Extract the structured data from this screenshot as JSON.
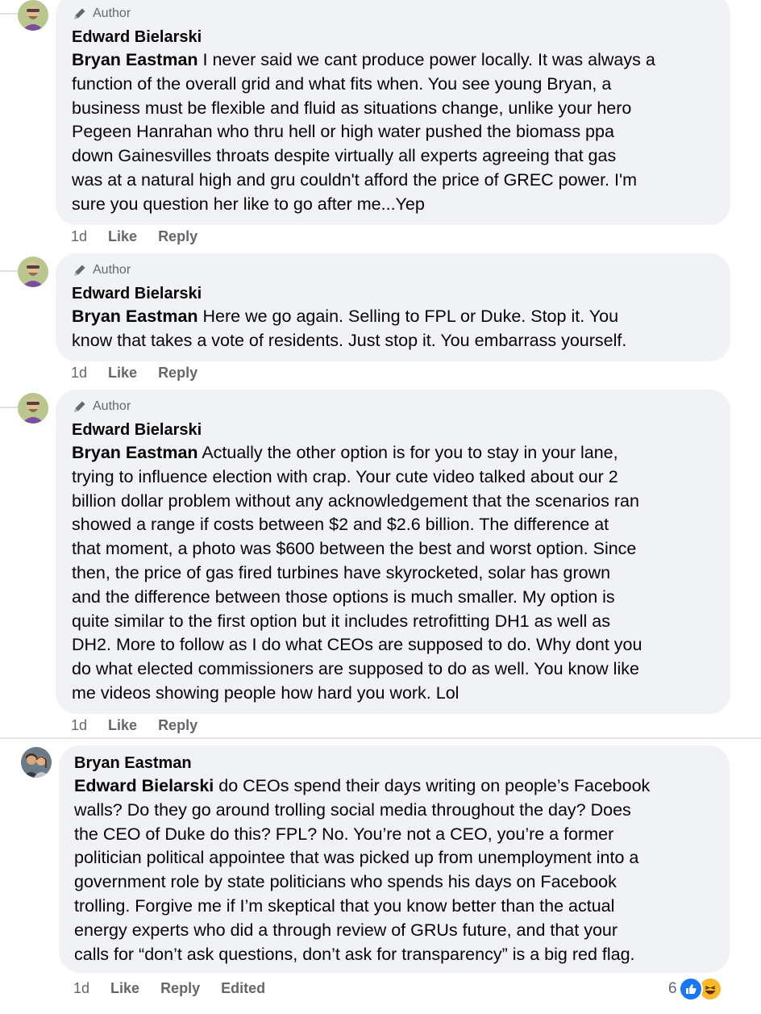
{
  "colors": {
    "bubble": "#f0f2f5",
    "text": "#050505",
    "meta": "#65676b",
    "like_blue": "#1877f2",
    "haha_yellow": "#f7b928"
  },
  "comments": [
    {
      "badge": "Author",
      "name": "Edward Bielarski",
      "mention": "Bryan Eastman",
      "lines": [
        " I never said we cant produce power locally. It was always a",
        "function of the overall grid and what fits when. You see young Bryan, a",
        "business must be flexible and fluid as situations change, unlike your hero",
        "Pegeen Hanrahan who thru hell or high water pushed the biomass ppa",
        "down Gainesvilles throats despite virtually all experts agreeing that gas",
        "was at a natural high and gru couldn't afford the price of GREC power. I'm",
        "sure you question her like to go after me...Yep"
      ],
      "time": "1d",
      "like": "Like",
      "reply": "Reply"
    },
    {
      "badge": "Author",
      "name": "Edward Bielarski",
      "mention": "Bryan Eastman",
      "lines": [
        " Here we go again. Selling to FPL or Duke. Stop it. You",
        "know that takes a vote of residents. Just stop it. You embarrass yourself."
      ],
      "time": "1d",
      "like": "Like",
      "reply": "Reply"
    },
    {
      "badge": "Author",
      "name": "Edward Bielarski",
      "mention": "Bryan Eastman",
      "lines": [
        " Actually the other option is for you to stay in your lane,",
        "trying to influence election with crap. Your cute video talked about our 2",
        "billion dollar problem without any acknowledgement that the scenarios ran",
        "showed a range if costs between $2 and $2.6 billion. The difference at",
        "that moment, a photo was $600 between the best and worst option. Since",
        "then, the price of gas fired turbines have skyrocketed, solar has grown",
        "and the difference between those options is much smaller. My option is",
        "quite similar to the first option but it includes retrofitting DH1 as well as",
        "DH2. More to follow as I do what CEOs are supposed to do. Why dont you",
        "do what elected commissioners are supposed to do as well. You know like",
        "me videos showing people how hard you work. Lol"
      ],
      "time": "1d",
      "like": "Like",
      "reply": "Reply"
    },
    {
      "name": "Bryan Eastman",
      "mention": "Edward Bielarski",
      "lines": [
        " do CEOs spend their days writing on people’s Facebook",
        "walls? Do they go around trolling social media throughout the day? Does",
        "the CEO of Duke do this? FPL? No. You’re not a CEO, you’re a former",
        "politician political appointee that was picked up from unemployment into a",
        "government role by state politicians who spends his days on Facebook",
        "trolling. Forgive me if I’m skeptical that you know better than the actual",
        "energy experts who did a through review of GRUs future, and that your",
        "calls for “don’t ask questions, don’t ask for transparency” is a big red flag."
      ],
      "time": "1d",
      "like": "Like",
      "reply": "Reply",
      "edited": "Edited",
      "reaction_count": "6",
      "reaction_icons": [
        "like-icon",
        "haha-icon"
      ]
    }
  ]
}
